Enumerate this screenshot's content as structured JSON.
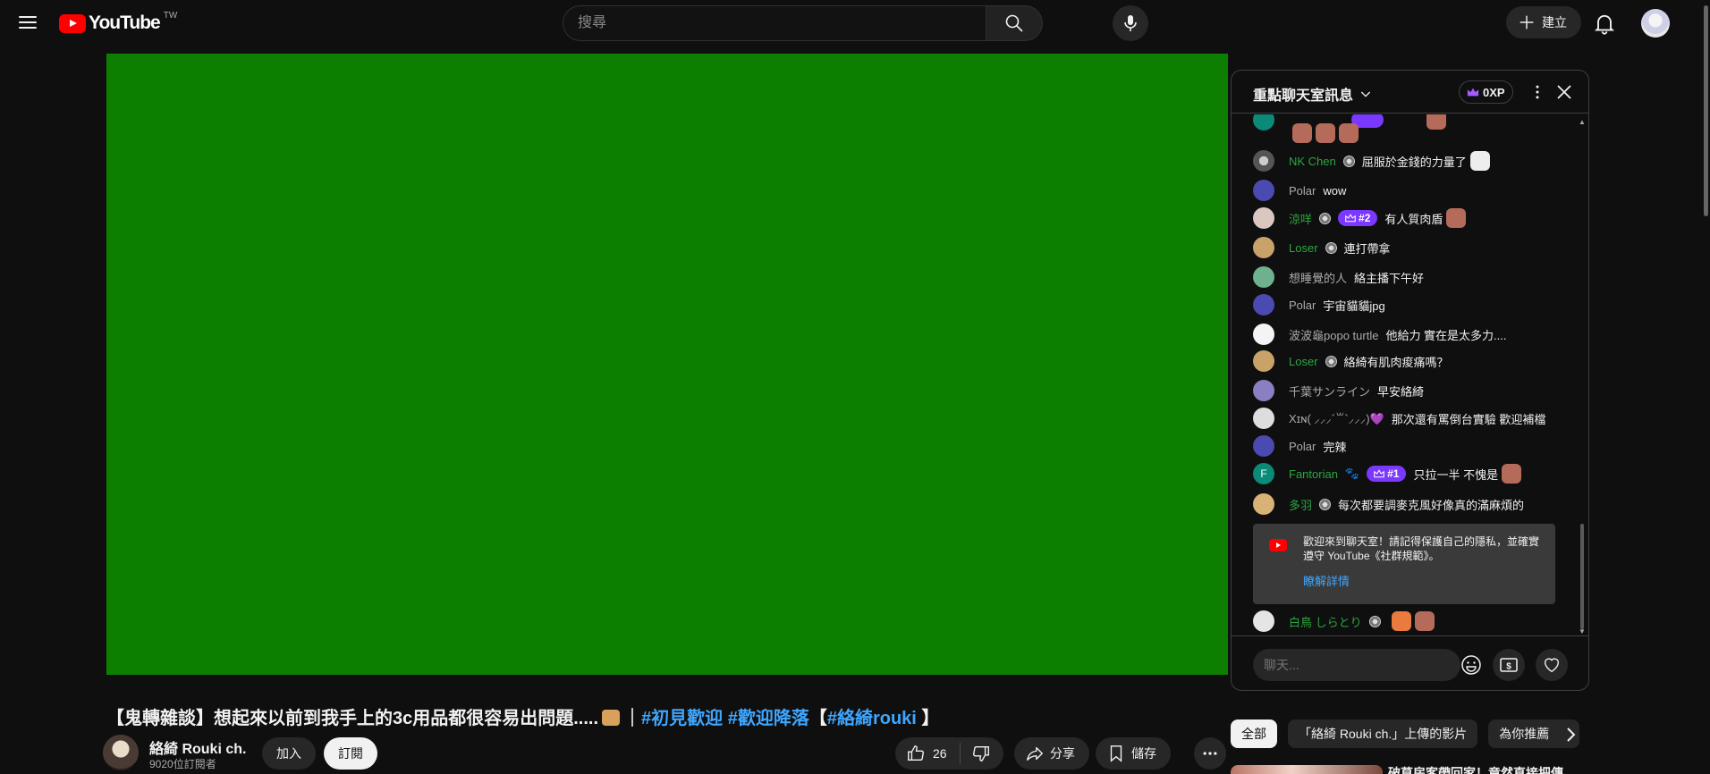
{
  "header": {
    "logo_text": "YouTube",
    "region": "TW",
    "search_placeholder": "搜尋",
    "create_label": "建立"
  },
  "video": {
    "title_main": "【鬼轉雜談】想起來以前到我手上的3c用品都很容易出問題.....",
    "title_sep": "｜",
    "hashtags": [
      "#初見歡迎",
      "#歡迎降落"
    ],
    "title_bracket_open": "【",
    "tag_rouki": "#絡綺rouki",
    "title_bracket_close": " 】",
    "player_color": "#0d7f00"
  },
  "channel": {
    "name": "絡綺 Rouki ch.",
    "subscribers": "9020位訂閱者",
    "join_label": "加入",
    "subscribe_label": "訂閱"
  },
  "actions": {
    "like_count": "26",
    "share_label": "分享",
    "save_label": "儲存"
  },
  "chat": {
    "mode_label": "重點聊天室訊息",
    "xp_label": "0XP",
    "input_placeholder": "聊天...",
    "superchat_label": "$",
    "messages": [
      {
        "author": "NK Chen",
        "text": "屈服於金錢的力量了"
      },
      {
        "author": "Polar",
        "text": "wow"
      },
      {
        "author": "涼咩",
        "rank": "#2",
        "text": "有人質肉盾"
      },
      {
        "author": "Loser",
        "text": "連打帶拿"
      },
      {
        "author": "想睡覺的人",
        "text": "絡主播下午好"
      },
      {
        "author": "Polar",
        "text": "宇宙貓貓jpg"
      },
      {
        "author": "波波龜popo turtle",
        "text": "他給力 實在是太多力...."
      },
      {
        "author": "Loser",
        "text": "絡綺有肌肉痠痛嗎？"
      },
      {
        "author": "千葉サンライン",
        "text": "早安絡綺"
      },
      {
        "author": "Xɪɴ( ⸝⸝⸝´꒳`⸝⸝⸝)💜",
        "text": "那次還有罵倒台實驗 歡迎補檔"
      },
      {
        "author": "Polar",
        "text": "完辣"
      },
      {
        "author": "Fantorian",
        "rank": "#1",
        "text": "只拉一半 不愧是"
      },
      {
        "author": "多羽",
        "text": "每次都要調麥克風好像真的滿麻煩的"
      },
      {
        "author": "白鳥 しらとり",
        "text": ""
      }
    ],
    "notice_text": "歡迎來到聊天室！請記得保護自己的隱私，並確實遵守 YouTube《社群規範》。",
    "notice_link": "瞭解詳情"
  },
  "chips": {
    "items": [
      "全部",
      "「絡綺 Rouki ch.」上傳的影片",
      "為你推薦"
    ]
  },
  "recommendation": {
    "title": "破草房客帶回家！竟然直接把傳"
  }
}
